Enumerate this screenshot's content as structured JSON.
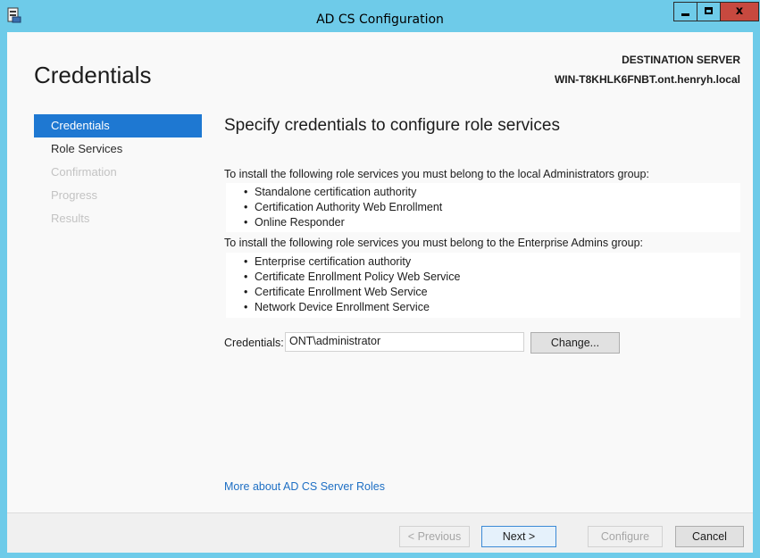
{
  "window": {
    "title": "AD CS Configuration",
    "close_glyph": "x"
  },
  "page": {
    "title": "Credentials",
    "destination_label": "DESTINATION SERVER",
    "destination_server": "WIN-T8KHLK6FNBT.ont.henryh.local"
  },
  "nav": {
    "items": [
      {
        "label": "Credentials",
        "state": "active"
      },
      {
        "label": "Role Services",
        "state": "enabled"
      },
      {
        "label": "Confirmation",
        "state": "disabled"
      },
      {
        "label": "Progress",
        "state": "disabled"
      },
      {
        "label": "Results",
        "state": "disabled"
      }
    ]
  },
  "main": {
    "heading": "Specify credentials to configure role services",
    "local_admin_text": "To install the following role services you must belong to the local Administrators group:",
    "local_admin_roles": [
      "Standalone certification authority",
      "Certification Authority Web Enrollment",
      "Online Responder"
    ],
    "enterprise_admin_text": "To install the following role services you must belong to the Enterprise Admins group:",
    "enterprise_admin_roles": [
      "Enterprise certification authority",
      "Certificate Enrollment Policy Web Service",
      "Certificate Enrollment Web Service",
      "Network Device Enrollment Service"
    ],
    "credentials_label": "Credentials:",
    "credentials_value": "ONT\\administrator",
    "change_label": "Change...",
    "more_link": "More about AD CS Server Roles"
  },
  "footer": {
    "previous_label": "< Previous",
    "next_label": "Next >",
    "configure_label": "Configure",
    "cancel_label": "Cancel"
  },
  "colors": {
    "titlebar": "#6ecbe9",
    "nav_active": "#1e78d2",
    "close_button": "#c7493f",
    "link": "#1e6fc4"
  }
}
